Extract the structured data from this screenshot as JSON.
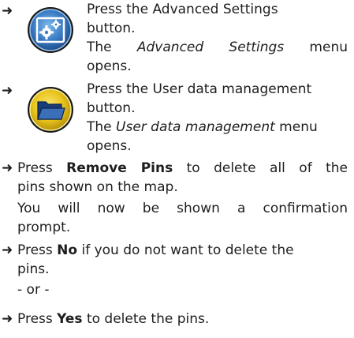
{
  "steps": [
    {
      "arrow": "➜",
      "icon": "advanced-settings-icon",
      "lines": [
        "Press the Advanced Settings",
        "button."
      ],
      "result_pre": "The ",
      "result_em": "Advanced Settings",
      "result_post": " menu",
      "result_line2": "opens."
    },
    {
      "arrow": "➜",
      "icon": "user-data-management-icon",
      "lines": [
        "Press the User data management",
        "button."
      ],
      "result_pre": "The ",
      "result_em": "User data management",
      "result_post": " menu",
      "result_line2": "opens."
    }
  ],
  "remove": {
    "arrow": "➜",
    "pre": "Press ",
    "bold": "Remove Pins",
    "post": " to delete all of the",
    "line2": "pins shown on the map.",
    "note_line1": "You will now be shown a confirmation",
    "note_line2": "prompt."
  },
  "no": {
    "arrow": "➜",
    "pre": "Press ",
    "bold": "No",
    "post": " if you do not want to delete the",
    "line2": "pins.",
    "or": "- or -"
  },
  "yes": {
    "arrow": "➜",
    "pre": "Press ",
    "bold": "Yes",
    "post": " to delete the pins."
  },
  "colors": {
    "icon_ring": "#1a1a1a",
    "icon_blue_outer": "#2f6fb5",
    "icon_blue_inner": "#5aa0dc",
    "icon_yellow_outer": "#e6c21a",
    "icon_yellow_inner": "#f4dc4a",
    "text": "#1e1e1e"
  }
}
